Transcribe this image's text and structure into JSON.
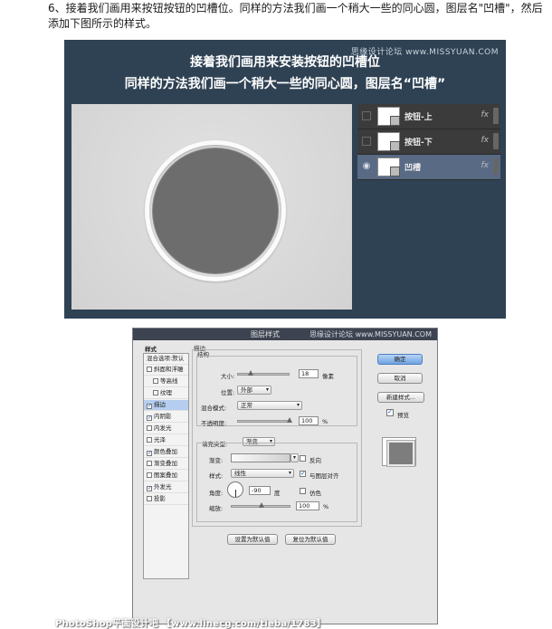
{
  "caption": "6、接着我们画用来按钮按钮的凹槽位。同样的方法我们画一个稍大一些的同心圆，图层名\"凹槽\"，然后添加下图所示的样式。",
  "top_panel": {
    "watermark": "思缘设计论坛 www.MISSYUAN.COM",
    "heading_line1": "接着我们画用来安装按钮的凹槽位",
    "heading_line2": "同样的方法我们画一个稍大一些的同心圆，图层名“凹槽”",
    "layers": [
      {
        "name": "按钮-上",
        "fx": "fx",
        "visible": false,
        "selected": false
      },
      {
        "name": "按钮-下",
        "fx": "fx",
        "visible": false,
        "selected": false
      },
      {
        "name": "凹槽",
        "fx": "fx",
        "visible": true,
        "selected": true
      }
    ]
  },
  "dialog": {
    "title": "图层样式",
    "watermark": "思缘设计论坛 www.MISSYUAN.COM",
    "styles_header": "样式",
    "blend_options": "混合选项:默认",
    "style_items": [
      {
        "label": "斜面和浮雕",
        "checked": false,
        "indent": false,
        "selected": false
      },
      {
        "label": "等高线",
        "checked": false,
        "indent": true,
        "selected": false
      },
      {
        "label": "纹理",
        "checked": false,
        "indent": true,
        "selected": false
      },
      {
        "label": "描边",
        "checked": true,
        "indent": false,
        "selected": true
      },
      {
        "label": "内阴影",
        "checked": true,
        "indent": false,
        "selected": false
      },
      {
        "label": "内发光",
        "checked": false,
        "indent": false,
        "selected": false
      },
      {
        "label": "光泽",
        "checked": false,
        "indent": false,
        "selected": false
      },
      {
        "label": "颜色叠加",
        "checked": true,
        "indent": false,
        "selected": false
      },
      {
        "label": "渐变叠加",
        "checked": false,
        "indent": false,
        "selected": false
      },
      {
        "label": "图案叠加",
        "checked": false,
        "indent": false,
        "selected": false
      },
      {
        "label": "外发光",
        "checked": true,
        "indent": false,
        "selected": false
      },
      {
        "label": "投影",
        "checked": false,
        "indent": false,
        "selected": false
      }
    ],
    "stroke": {
      "group_title": "描边",
      "structure_title": "结构",
      "size_label": "大小:",
      "size_value": "18",
      "size_unit": "像素",
      "size_fraction": 0.22,
      "position_label": "位置:",
      "position_value": "外部",
      "blend_mode_label": "混合模式:",
      "blend_mode_value": "正常",
      "opacity_label": "不透明度:",
      "opacity_value": "100",
      "opacity_unit": "%",
      "opacity_fraction": 1.0,
      "fill_type_label": "填充类型:",
      "fill_type_value": "渐变",
      "gradient_label": "渐变:",
      "reverse_label": "反向",
      "reverse_checked": false,
      "style_label": "样式:",
      "style_value": "线性",
      "align_label": "与图层对齐",
      "align_checked": true,
      "angle_label": "角度:",
      "angle_value": "-90",
      "angle_unit": "度",
      "dither_label": "仿色",
      "dither_checked": false,
      "scale_label": "缩放:",
      "scale_value": "100",
      "scale_unit": "%",
      "scale_fraction": 0.5,
      "set_default_button": "设置为默认值",
      "reset_default_button": "复位为默认值"
    },
    "ok_button": "确定",
    "cancel_button": "取消",
    "new_style_button": "新建样式...",
    "preview_label": "预览",
    "preview_checked": true
  },
  "footer": "PhotoShop平面设计吧 【www.linecg.com/tieba/1783】",
  "colors": {
    "panel_bg": "#2f4254",
    "selected_layer": "#596a85",
    "dialog_title": "#3d4350",
    "primary_button": "#6fa3e0"
  }
}
